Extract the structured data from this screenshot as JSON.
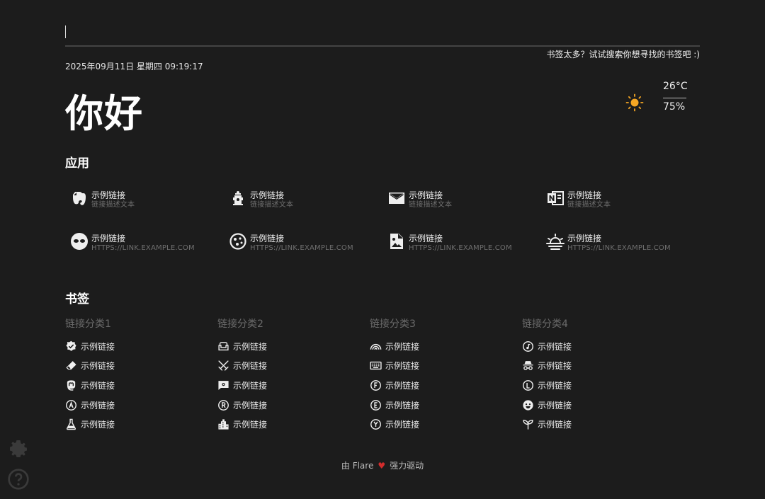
{
  "search": {
    "placeholder": "",
    "value": "",
    "hint": "书签太多？试试搜索你想寻找的书签吧 :)"
  },
  "datetime": "2025年09月11日 星期四 09:19:17",
  "greeting": "你好",
  "weather": {
    "temperature": "26°C",
    "humidity": "75%",
    "icon": "sun-icon",
    "icon_color": "#f5a623"
  },
  "apps_section": {
    "title": "应用",
    "items": [
      {
        "name": "示例链接",
        "desc": "链接描述文本",
        "icon": "evernote-icon"
      },
      {
        "name": "示例链接",
        "desc": "链接描述文本",
        "icon": "fire-hydrant-icon"
      },
      {
        "name": "示例链接",
        "desc": "链接描述文本",
        "icon": "email-icon"
      },
      {
        "name": "示例链接",
        "desc": "链接描述文本",
        "icon": "onenote-icon"
      },
      {
        "name": "示例链接",
        "desc": "HTTPS://LINK.EXAMPLE.COM",
        "icon": "drama-mask-icon"
      },
      {
        "name": "示例链接",
        "desc": "HTTPS://LINK.EXAMPLE.COM",
        "icon": "cookie-icon"
      },
      {
        "name": "示例链接",
        "desc": "HTTPS://LINK.EXAMPLE.COM",
        "icon": "image-file-icon"
      },
      {
        "name": "示例链接",
        "desc": "HTTPS://LINK.EXAMPLE.COM",
        "icon": "sunset-icon"
      }
    ]
  },
  "bookmarks_section": {
    "title": "书签",
    "categories": [
      {
        "title": "链接分类1",
        "links": [
          {
            "name": "示例链接",
            "icon": "check-decagram-icon"
          },
          {
            "name": "示例链接",
            "icon": "eraser-icon"
          },
          {
            "name": "示例链接",
            "icon": "mastodon-icon"
          },
          {
            "name": "示例链接",
            "icon": "alpha-a-circle-icon"
          },
          {
            "name": "示例链接",
            "icon": "flask-icon"
          }
        ]
      },
      {
        "title": "链接分类2",
        "links": [
          {
            "name": "示例链接",
            "icon": "sofa-icon"
          },
          {
            "name": "示例链接",
            "icon": "sword-cross-icon"
          },
          {
            "name": "示例链接",
            "icon": "message-gear-icon"
          },
          {
            "name": "示例链接",
            "icon": "alpha-r-circle-icon"
          },
          {
            "name": "示例链接",
            "icon": "city-icon"
          }
        ]
      },
      {
        "title": "链接分类3",
        "links": [
          {
            "name": "示例链接",
            "icon": "rainbow-icon"
          },
          {
            "name": "示例链接",
            "icon": "keyboard-icon"
          },
          {
            "name": "示例链接",
            "icon": "alpha-f-circle-icon"
          },
          {
            "name": "示例链接",
            "icon": "alpha-e-circle-icon"
          },
          {
            "name": "示例链接",
            "icon": "alpha-y-circle-icon"
          }
        ]
      },
      {
        "title": "链接分类4",
        "links": [
          {
            "name": "示例链接",
            "icon": "music-note-circle-icon"
          },
          {
            "name": "示例链接",
            "icon": "incognito-icon"
          },
          {
            "name": "示例链接",
            "icon": "alpha-l-circle-icon"
          },
          {
            "name": "示例链接",
            "icon": "emoticon-icon"
          },
          {
            "name": "示例链接",
            "icon": "sprout-icon"
          }
        ]
      }
    ]
  },
  "footer": {
    "prefix": "由 Flare",
    "heart": "♥",
    "suffix": "强力驱动"
  },
  "side": {
    "settings_icon": "gear-icon",
    "help_icon": "help-circle-icon"
  }
}
